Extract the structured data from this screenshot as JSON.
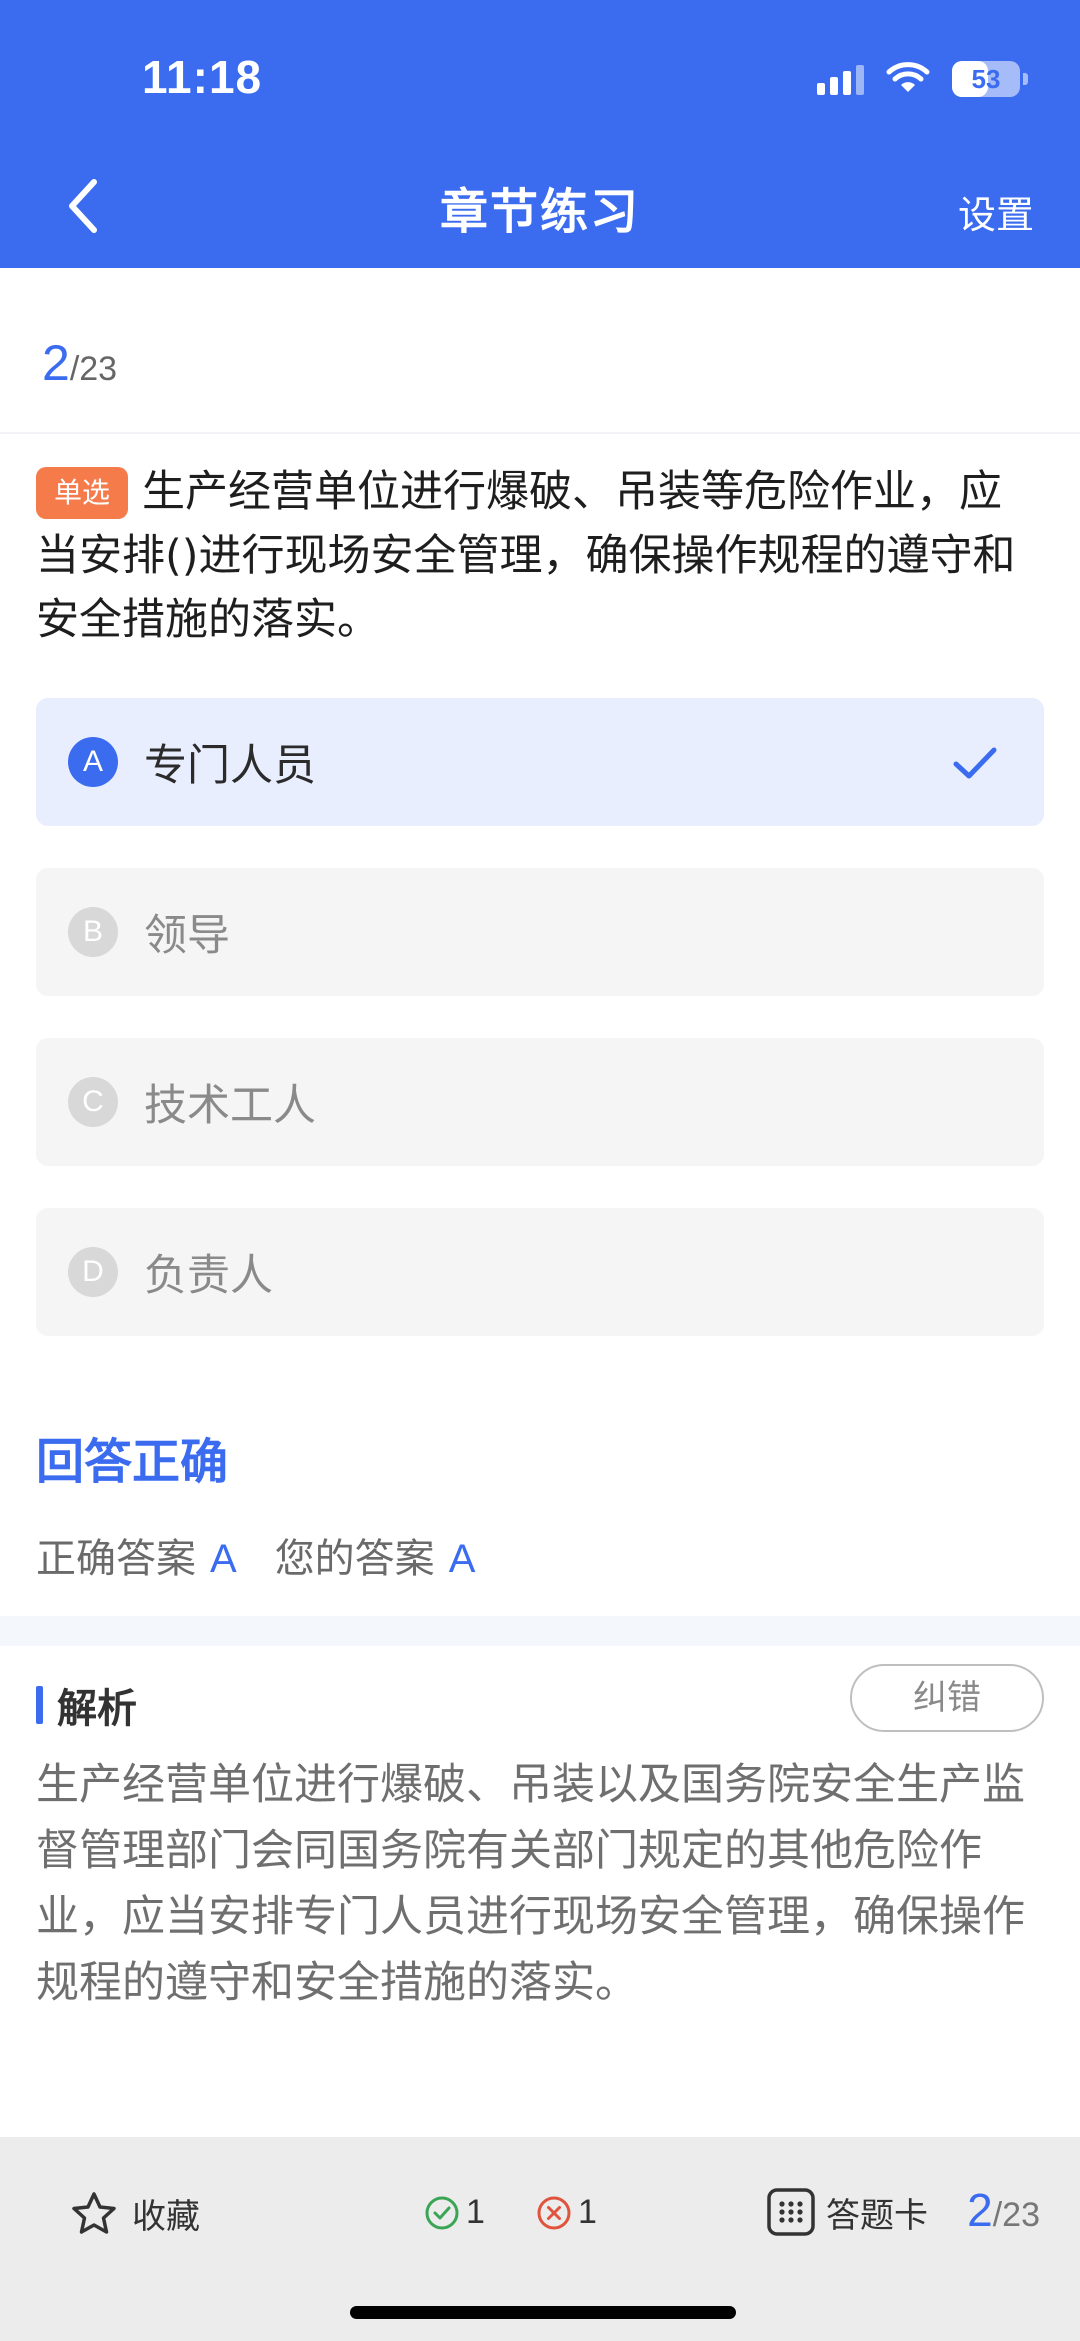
{
  "status_bar": {
    "time": "11:18",
    "battery": "53",
    "battery_level": 0.53
  },
  "header": {
    "title": "章节练习",
    "settings_label": "设置"
  },
  "progress": {
    "current": "2",
    "total": "/23"
  },
  "question": {
    "type_label": "单选",
    "text": "生产经营单位进行爆破、吊装等危险作业，应当安排()进行现场安全管理，确保操作规程的遵守和安全措施的落实。"
  },
  "options": [
    {
      "letter": "A",
      "text": "专门人员",
      "selected": true
    },
    {
      "letter": "B",
      "text": "领导",
      "selected": false
    },
    {
      "letter": "C",
      "text": "技术工人",
      "selected": false
    },
    {
      "letter": "D",
      "text": "负责人",
      "selected": false
    }
  ],
  "result": {
    "title": "回答正确",
    "correct_label": "正确答案",
    "correct_value": "A",
    "yours_label": "您的答案",
    "yours_value": "A"
  },
  "analysis": {
    "title": "解析",
    "report_label": "纠错",
    "text": "生产经营单位进行爆破、吊装以及国务院安全生产监督管理部门会同国务院有关部门规定的其他危险作业，应当安排专门人员进行现场安全管理，确保操作规程的遵守和安全措施的落实。"
  },
  "bottom_bar": {
    "favorite_label": "收藏",
    "correct_count": "1",
    "wrong_count": "1",
    "answer_card_label": "答题卡",
    "current": "2",
    "total": "/23"
  },
  "colors": {
    "accent": "#3b6cf0",
    "type_badge": "#f57b4b",
    "correct": "#3aa655",
    "wrong": "#e0533d"
  }
}
